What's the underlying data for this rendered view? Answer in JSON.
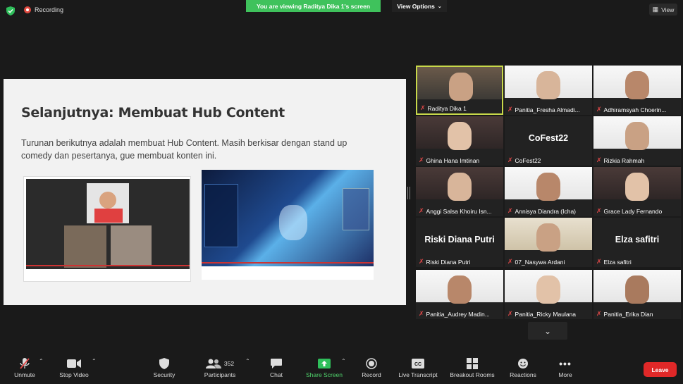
{
  "topbar": {
    "recording_label": "Recording",
    "viewing_banner": "You are viewing Raditya Dika 1's screen",
    "view_options": "View Options",
    "view_button": "View"
  },
  "slide": {
    "title": "Selanjutnya: Membuat Hub Content",
    "body": "Turunan berikutnya adalah membuat Hub Content. Masih berkisar dengan stand up comedy dan pesertanya, gue membuat konten ini."
  },
  "participants": [
    {
      "name": "Raditya Dika 1",
      "active": true
    },
    {
      "name": "Panitia_Fresha Almadi..."
    },
    {
      "name": "Adhiramsyah Choerin..."
    },
    {
      "name": "Ghina Hana Imtinan"
    },
    {
      "name": "CoFest22",
      "big": "CoFest22"
    },
    {
      "name": "Rizkia Rahmah"
    },
    {
      "name": "Anggi Salsa Khoiru Isn..."
    },
    {
      "name": "Annisya Diandra (Icha)"
    },
    {
      "name": "Grace Lady Fernando"
    },
    {
      "name": "Riski Diana Putri",
      "big": "Riski Diana Putri"
    },
    {
      "name": "07_Nasywa Ardani"
    },
    {
      "name": "Elza safitri",
      "big": "Elza safitri"
    },
    {
      "name": "Panitia_Audrey Madin..."
    },
    {
      "name": "Panitia_Ricky Maulana"
    },
    {
      "name": "Panitia_Erika Dian"
    }
  ],
  "toolbar": {
    "unmute": "Unmute",
    "stop_video": "Stop Video",
    "security": "Security",
    "participants": "Participants",
    "participants_count": "352",
    "chat": "Chat",
    "share_screen": "Share Screen",
    "record": "Record",
    "live_transcript": "Live Transcript",
    "breakout_rooms": "Breakout Rooms",
    "reactions": "Reactions",
    "more": "More",
    "leave": "Leave"
  }
}
